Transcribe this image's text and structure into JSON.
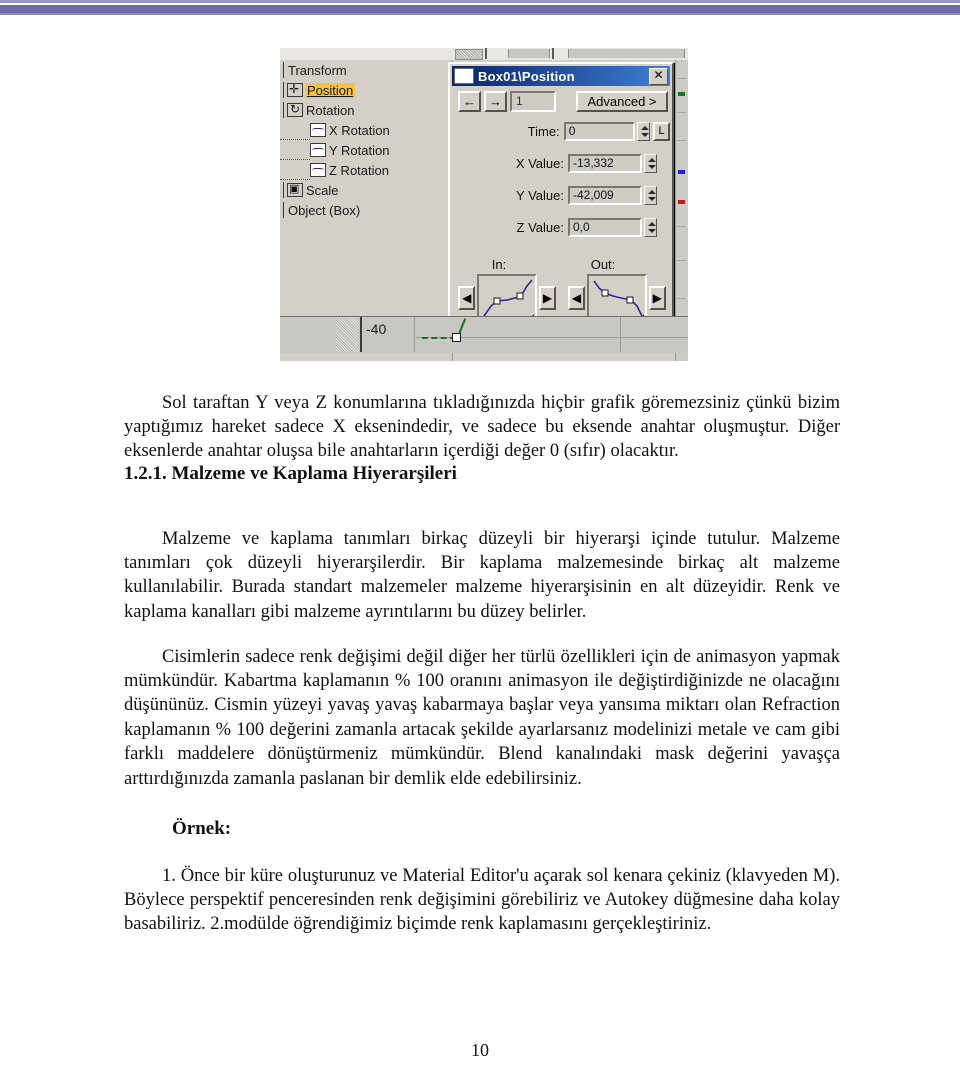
{
  "page": {
    "number": "10"
  },
  "figure": {
    "tracklist": [
      {
        "label": "Transform",
        "icon": "none",
        "indent": 0,
        "selected": false,
        "stub": true
      },
      {
        "label": "Position",
        "icon": "move-icon",
        "indent": 0,
        "selected": true,
        "stub": true
      },
      {
        "label": "Rotation",
        "icon": "rotate-icon",
        "indent": 0,
        "selected": false,
        "stub": true
      },
      {
        "label": "X Rotation",
        "icon": "curve-icon",
        "indent": 1,
        "selected": false,
        "stub": false
      },
      {
        "label": "Y Rotation",
        "icon": "curve-icon",
        "indent": 1,
        "selected": false,
        "stub": false
      },
      {
        "label": "Z Rotation",
        "icon": "curve-icon",
        "indent": 1,
        "selected": false,
        "stub": false
      },
      {
        "label": "Scale",
        "icon": "scale-icon",
        "indent": 0,
        "selected": false,
        "stub": true
      },
      {
        "label": "Object (Box)",
        "icon": "none",
        "indent": 0,
        "selected": false,
        "stub": true
      }
    ],
    "dialog": {
      "title": "Box01\\Position",
      "close_label": "✕",
      "prev_key_label": "←",
      "next_key_label": "→",
      "key_index": "1",
      "advanced_label": "Advanced >",
      "fields": [
        {
          "label": "Time:",
          "value": "0",
          "lock_label": "L"
        },
        {
          "label": "X Value:",
          "value": "-13,332",
          "lock_label": ""
        },
        {
          "label": "Y Value:",
          "value": "-42,009",
          "lock_label": ""
        },
        {
          "label": "Z Value:",
          "value": "0,0",
          "lock_label": ""
        }
      ],
      "curves": {
        "in_label": "In:",
        "out_label": "Out:",
        "prev_label": "◀",
        "next_label": "▶"
      }
    },
    "timeline": {
      "value_label": "-40"
    },
    "colors": {
      "titlebar_start": "#0a246a",
      "titlebar_end": "#3f7fd4",
      "dialog_face": "#d4d0c8",
      "selection_highlight": "#f5c342",
      "curve_stroke": "#2b2b8f",
      "key_green": "#14761f",
      "marker_green": "#0f7a1e",
      "marker_blue": "#1f24c6",
      "marker_red": "#c11a1a"
    }
  },
  "document": {
    "paragraph_intro": "Sol taraftan Y veya Z konumlarına tıkladığınızda hiçbir grafik göremezsiniz çünkü bizim yaptığımız hareket sadece X eksenindedir, ve sadece bu eksende anahtar oluşmuştur. Diğer eksenlerde anahtar oluşsa bile anahtarların içerdiği değer 0 (sıfır) olacaktır.",
    "section_heading": "1.2.1. Malzeme ve Kaplama Hiyerarşileri",
    "paragraph_2": "Malzeme ve kaplama tanımları birkaç düzeyli bir hiyerarşi içinde tutulur. Malzeme tanımları çok düzeyli hiyerarşilerdir. Bir kaplama malzemesinde birkaç alt malzeme kullanılabilir. Burada standart malzemeler malzeme hiyerarşisinin en alt düzeyidir. Renk ve kaplama kanalları gibi malzeme ayrıntılarını bu düzey belirler.",
    "paragraph_3": "Cisimlerin sadece renk değişimi değil diğer her türlü özellikleri için de animasyon yapmak mümkündür. Kabartma kaplamanın % 100 oranını animasyon ile değiştirdiğinizde ne olacağını düşününüz. Cismin yüzeyi yavaş yavaş kabarmaya başlar  veya yansıma miktarı olan Refraction  kaplamanın % 100 değerini zamanla artacak şekilde ayarlarsanız modelinizi metale ve cam gibi farklı maddelere dönüştürmeniz mümkündür. Blend kanalındaki mask değerini yavaşça arttırdığınızda zamanla paslanan bir demlik elde edebilirsiniz.",
    "example_label": "Örnek:",
    "paragraph_4": "1. Önce bir küre oluşturunuz ve Material Editor'u açarak sol kenara çekiniz (klavyeden M). Böylece perspektif penceresinden renk değişimini görebiliriz ve Autokey düğmesine daha kolay basabiliriz. 2.modülde öğrendiğimiz biçimde renk kaplamasını gerçekleştiriniz."
  }
}
